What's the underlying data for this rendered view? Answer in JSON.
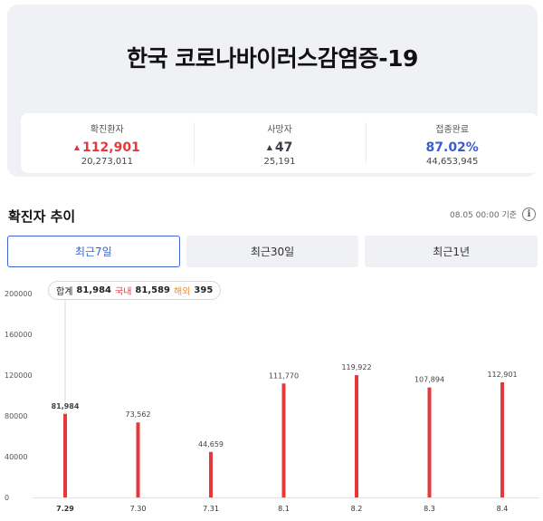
{
  "header": {
    "title": "한국 코로나바이러스감염증-19"
  },
  "stats": [
    {
      "label": "확진환자",
      "value": "112,901",
      "sub": "20,273,011",
      "arrow": "▲",
      "color": "#e5383b"
    },
    {
      "label": "사망자",
      "value": "47",
      "sub": "25,191",
      "arrow": "▲",
      "color": "#3b3f4a"
    },
    {
      "label": "접종완료",
      "value": "87.02%",
      "sub": "44,653,945",
      "arrow": "",
      "color": "#3c5cce"
    }
  ],
  "trend": {
    "title": "확진자 추이",
    "basis": "08.05 00:00 기준",
    "info_icon": "info-icon"
  },
  "tabs": [
    {
      "label": "최근7일",
      "active": true
    },
    {
      "label": "최근30일",
      "active": false
    },
    {
      "label": "최근1년",
      "active": false
    }
  ],
  "tooltip": {
    "total_label": "합계",
    "total_value": "81,984",
    "domestic_label": "국내",
    "domestic_value": "81,589",
    "overseas_label": "해외",
    "overseas_value": "395"
  },
  "colors": {
    "bar": "#e5383b",
    "accent_blue": "#3c63d6",
    "overseas": "#f08c2e"
  },
  "chart_data": {
    "type": "bar",
    "categories": [
      "7.29",
      "7.30",
      "7.31",
      "8.1",
      "8.2",
      "8.3",
      "8.4"
    ],
    "values": [
      81984,
      73562,
      44659,
      111770,
      119922,
      107894,
      112901
    ],
    "value_labels": [
      "81,984",
      "73,562",
      "44,659",
      "111,770",
      "119,922",
      "107,894",
      "112,901"
    ],
    "y_ticks": [
      0,
      40000,
      80000,
      120000,
      160000,
      200000
    ],
    "ylim": [
      0,
      200000
    ],
    "selected_index": 0,
    "grid": false
  }
}
